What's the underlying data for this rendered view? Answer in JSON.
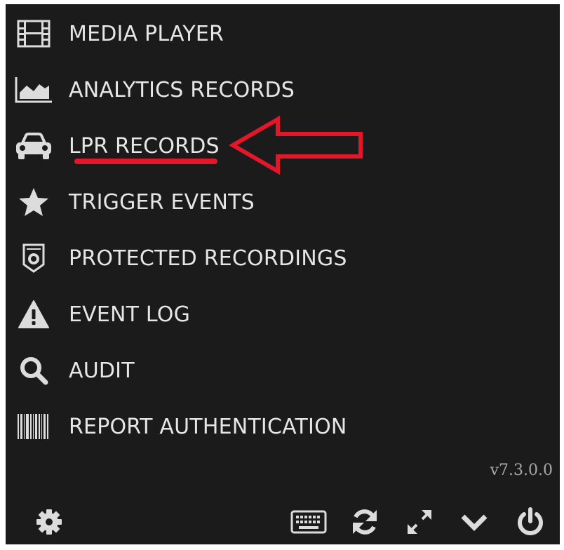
{
  "menu": {
    "items": [
      {
        "label": "MEDIA PLAYER",
        "icon": "film-icon"
      },
      {
        "label": "ANALYTICS RECORDS",
        "icon": "area-chart-icon"
      },
      {
        "label": "LPR RECORDS",
        "icon": "car-icon"
      },
      {
        "label": "TRIGGER EVENTS",
        "icon": "star-icon"
      },
      {
        "label": "PROTECTED RECORDINGS",
        "icon": "shield-badge-icon"
      },
      {
        "label": "EVENT LOG",
        "icon": "warning-icon"
      },
      {
        "label": "AUDIT",
        "icon": "search-icon"
      },
      {
        "label": "REPORT AUTHENTICATION",
        "icon": "barcode-icon"
      }
    ],
    "highlighted": "LPR RECORDS"
  },
  "footer": {
    "version": "v7.3.0.0",
    "buttons": [
      "gear-icon",
      "keyboard-icon",
      "refresh-icon",
      "expand-icon",
      "chevron-down-icon",
      "power-icon"
    ]
  },
  "colors": {
    "background": "#1b1b1b",
    "text": "#e6e6e6",
    "icon": "#dcdcdc",
    "annotation": "#e3162a"
  }
}
